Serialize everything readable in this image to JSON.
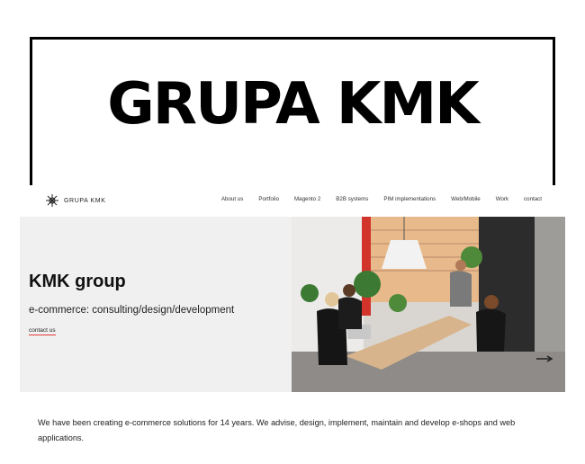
{
  "title_banner": {
    "text": "GRUPA KMK"
  },
  "header": {
    "logo_text": "GRUPA KMK",
    "nav": [
      "About us",
      "Portfolio",
      "Magento 2",
      "B2B systems",
      "PIM implementations",
      "Web/Mobile",
      "Work",
      "contact"
    ]
  },
  "hero": {
    "heading": "KMK group",
    "subheading": "e-commerce: consulting/design/development",
    "link": "contact us",
    "accent_color": "#e53935"
  },
  "intro": {
    "text": "We have been creating e-commerce solutions for 14 years. We advise, design, implement, maintain and develop e-shops and web applications."
  }
}
